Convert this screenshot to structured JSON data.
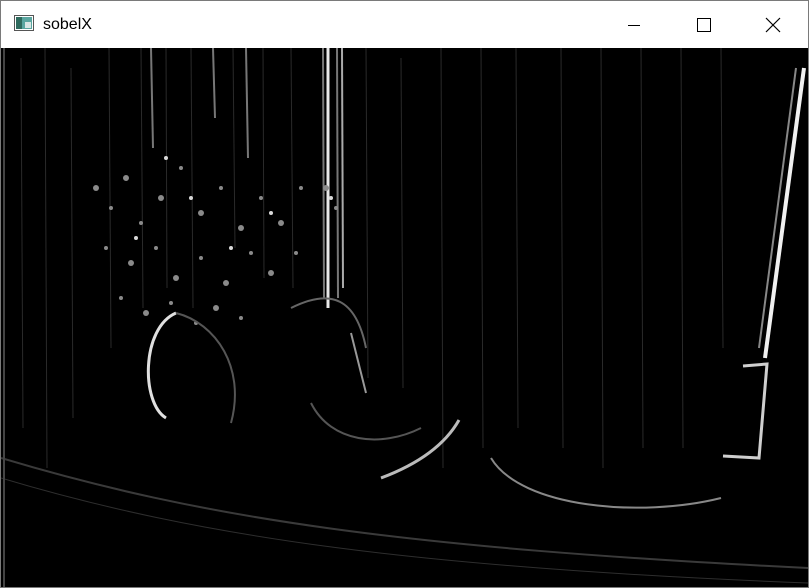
{
  "window": {
    "title": "sobelX",
    "app_icon": "opencv-window-icon",
    "controls": {
      "minimize_icon": "minimize-icon",
      "maximize_icon": "maximize-icon",
      "close_icon": "close-icon"
    }
  },
  "image": {
    "description_icon": "sobel-x-edge-image",
    "background_color": "#000000",
    "edge_color": "#ffffff"
  }
}
